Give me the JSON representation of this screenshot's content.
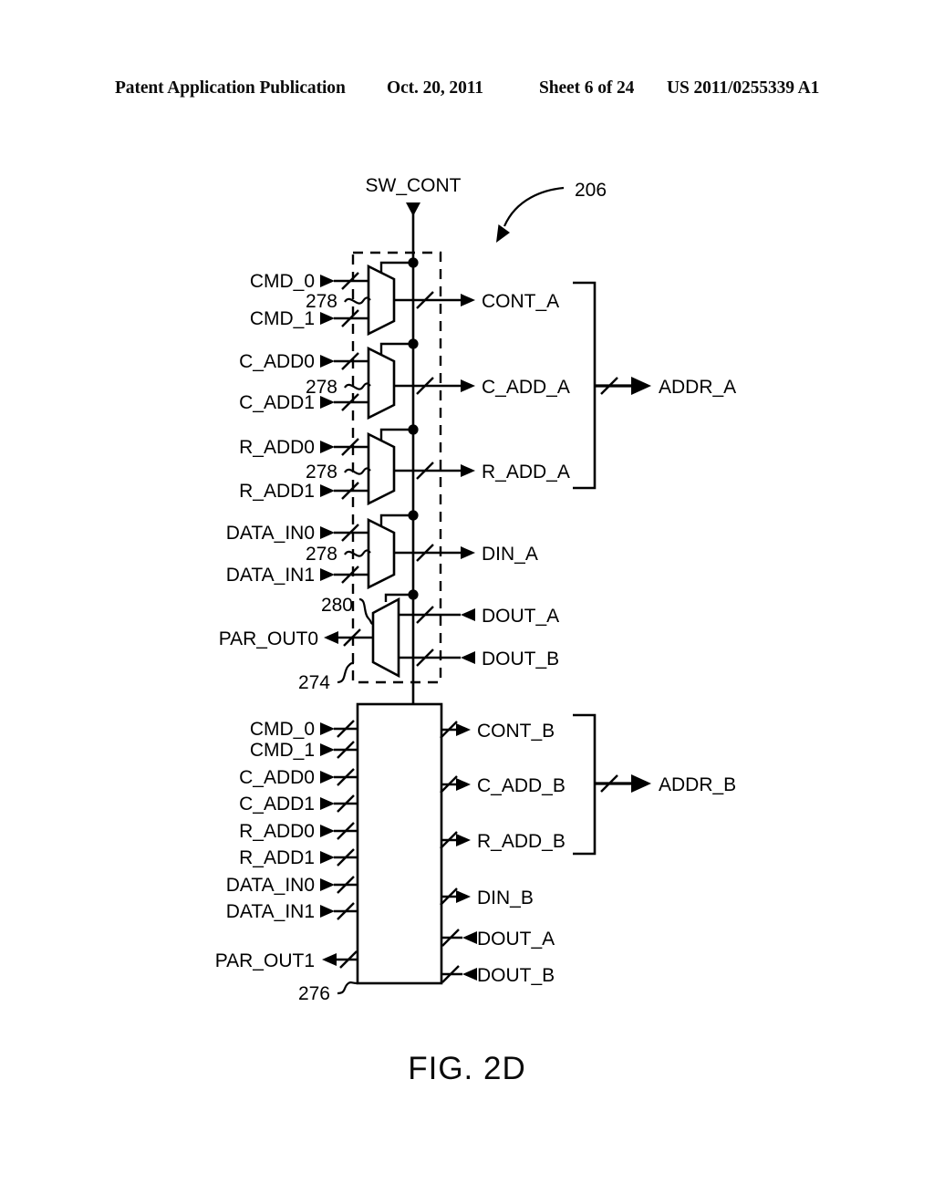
{
  "header": {
    "publication": "Patent Application Publication",
    "date": "Oct. 20, 2011",
    "sheet": "Sheet 6 of 24",
    "number": "US 2011/0255339 A1"
  },
  "figure": {
    "caption": "FIG. 2D",
    "callout": "206",
    "control_signal": "SW_CONT",
    "mux_block_ref": "274",
    "lower_block_ref": "276",
    "demux_ref": "280",
    "mux_ref": "278",
    "mux_rows": [
      {
        "ref": "278",
        "in0": "CMD_0",
        "in1": "CMD_1",
        "out": "CONT_A"
      },
      {
        "ref": "278",
        "in0": "C_ADD0",
        "in1": "C_ADD1",
        "out": "C_ADD_A"
      },
      {
        "ref": "278",
        "in0": "R_ADD0",
        "in1": "R_ADD1",
        "out": "R_ADD_A"
      },
      {
        "ref": "278",
        "in0": "DATA_IN0",
        "in1": "DATA_IN1",
        "out": "DIN_A"
      }
    ],
    "demux_row": {
      "ref": "280",
      "in": "PAR_OUT0",
      "out0": "DOUT_A",
      "out1": "DOUT_B"
    },
    "bracket_a_label": "ADDR_A",
    "bracket_b_label": "ADDR_B",
    "lower_block": {
      "ref": "276",
      "inputs": [
        "CMD_0",
        "CMD_1",
        "C_ADD0",
        "C_ADD1",
        "R_ADD0",
        "R_ADD1",
        "DATA_IN0",
        "DATA_IN1",
        "PAR_OUT1"
      ],
      "outputs": [
        "CONT_B",
        "C_ADD_B",
        "R_ADD_B",
        "DIN_B",
        "DOUT_A",
        "DOUT_B"
      ]
    }
  },
  "colors": {
    "ink": "#000000",
    "paper": "#ffffff"
  }
}
